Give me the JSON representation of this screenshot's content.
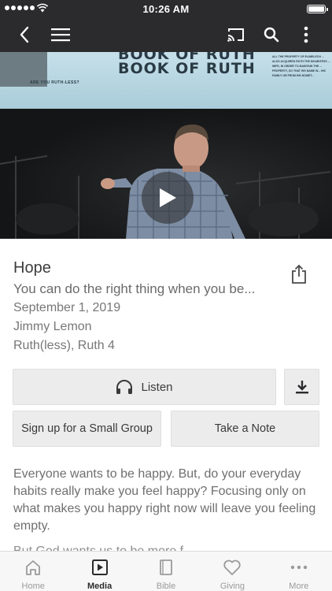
{
  "status_bar": {
    "time": "10:26 AM"
  },
  "nav": {
    "back_icon": "chevron-left-icon",
    "menu_icon": "hamburger-menu-icon",
    "cast_icon": "cast-icon",
    "search_icon": "search-icon",
    "more_icon": "more-vertical-icon"
  },
  "video": {
    "screen_title_line1": "BOOK OF RUTH",
    "screen_title_line2": "BOOK OF RUTH",
    "screen_subtitle": "ARE YOU RUTH-LESS?",
    "screen_note": "ALL THE PROPERTY OF ELIMELECH ... ALSO ACQUIRED RUTH THE MOABITESS ... WIFE, IN ORDER TO MAINTAIN THE ... PROPERTY, SO THAT HIS NAME W... HIS FAMILY OR FROM HIS HOMET...",
    "play_icon": "play-icon"
  },
  "sermon": {
    "title": "Hope",
    "subtitle": "You can do the right thing when you be...",
    "date": "September 1, 2019",
    "speaker": "Jimmy Lemon",
    "series": "Ruth(less), Ruth 4"
  },
  "actions": {
    "listen_label": "Listen",
    "small_group_label": "Sign up for a Small Group",
    "take_note_label": "Take a Note"
  },
  "description": {
    "text": "Everyone wants to be happy. But, do your everyday habits really make you feel happy? Focusing only on what makes you happy right now will leave you feeling empty.",
    "more": "But God wants us to be more f..."
  },
  "tabs": [
    {
      "label": "Home",
      "icon": "home-icon",
      "active": false
    },
    {
      "label": "Media",
      "icon": "media-play-icon",
      "active": true
    },
    {
      "label": "Bible",
      "icon": "bible-icon",
      "active": false
    },
    {
      "label": "Giving",
      "icon": "heart-icon",
      "active": false
    },
    {
      "label": "More",
      "icon": "more-horizontal-icon",
      "active": false
    }
  ],
  "colors": {
    "nav_background": "#2b2b2e",
    "button_background": "#ececed",
    "active_tab": "#2b2b2e",
    "inactive_tab": "#9a9a9a"
  }
}
